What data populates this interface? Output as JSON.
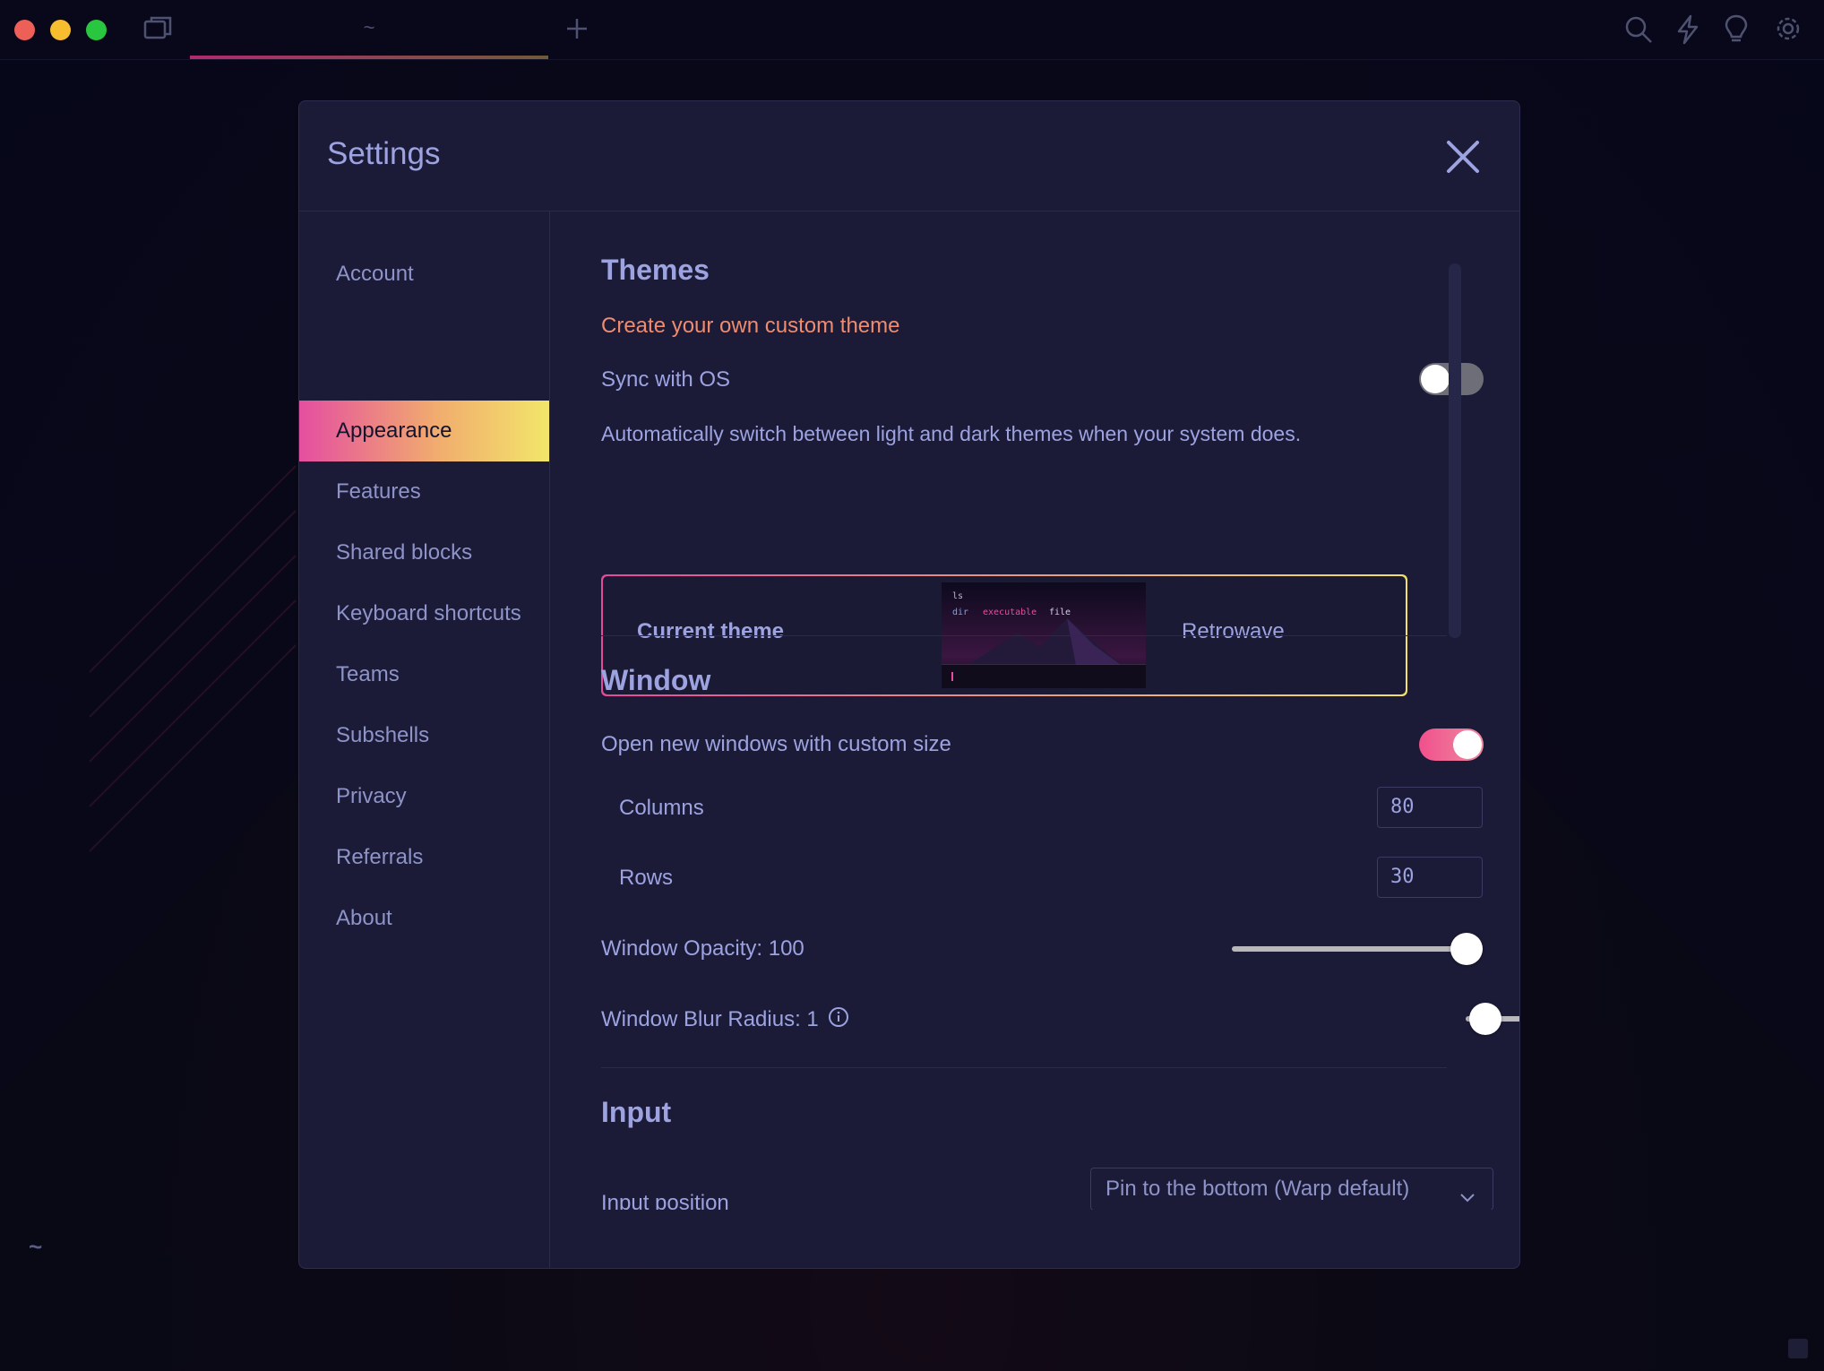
{
  "titlebar": {
    "active_tab_label": "~",
    "icons": [
      "split-pane-icon",
      "new-tab-plus-icon",
      "search-icon",
      "lightning-icon",
      "lightbulb-icon",
      "gear-icon"
    ]
  },
  "prompt_tilde": "~",
  "settings": {
    "title": "Settings",
    "nav": [
      {
        "label": "Account"
      },
      {
        "label": "Appearance"
      },
      {
        "label": "Features"
      },
      {
        "label": "Shared blocks"
      },
      {
        "label": "Keyboard shortcuts"
      },
      {
        "label": "Teams"
      },
      {
        "label": "Subshells"
      },
      {
        "label": "Privacy"
      },
      {
        "label": "Referrals"
      },
      {
        "label": "About"
      }
    ],
    "active_nav": "Appearance",
    "themes": {
      "title": "Themes",
      "custom_theme_link": "Create your own custom theme",
      "sync_label": "Sync with OS",
      "sync_enabled": false,
      "sync_description": "Automatically switch between light and dark themes when your system does.",
      "current_theme_label": "Current theme",
      "current_theme_name": "Retrowave",
      "preview": {
        "line1": "ls",
        "line2_dir": "dir",
        "line2_exec": "executable",
        "line2_file": "file"
      }
    },
    "window": {
      "title": "Window",
      "custom_size_label": "Open new windows with custom size",
      "custom_size_enabled": true,
      "columns_label": "Columns",
      "columns_value": "80",
      "rows_label": "Rows",
      "rows_value": "30",
      "opacity_label": "Window Opacity: 100",
      "opacity_value": 100,
      "opacity_max": 100,
      "blur_label": "Window Blur Radius: 1",
      "blur_value": 1,
      "blur_max": 64
    },
    "input": {
      "title": "Input",
      "position_label": "Input position",
      "position_value": "Pin to the bottom (Warp default)"
    }
  },
  "colors": {
    "accent_pink": "#e54ea0",
    "accent_yellow": "#f2e66a",
    "link_orange": "#ef8b6f",
    "text_lavender": "#9da3e0"
  }
}
